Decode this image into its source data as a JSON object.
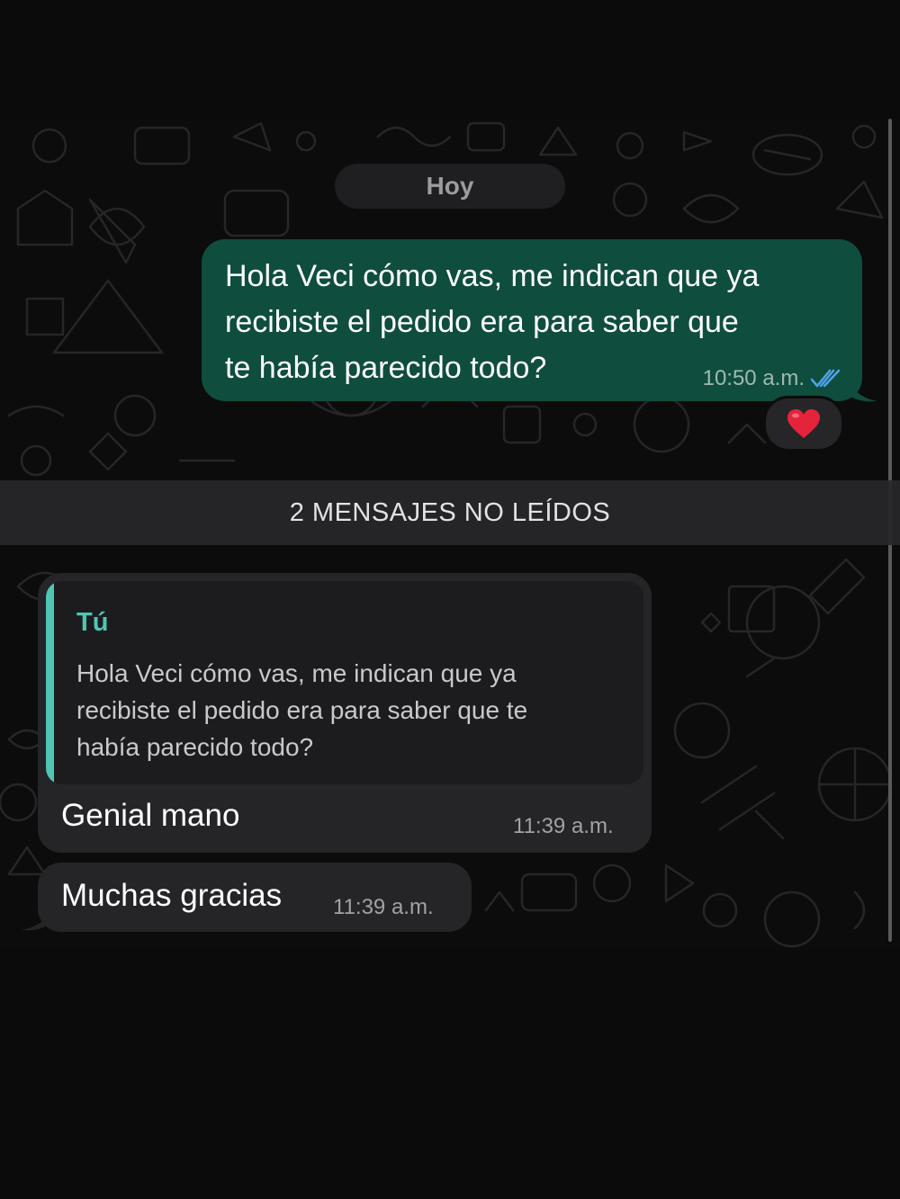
{
  "chat": {
    "date_label": "Hoy",
    "outgoing_message": {
      "lines": [
        "Hola Veci cómo vas, me indican que ya",
        "recibiste el pedido era para saber que",
        "te había parecido todo?"
      ],
      "time": "10:50 a.m.",
      "status_icon": "double-check-icon",
      "reaction": "❤️"
    },
    "unread_divider": "2 MENSAJES NO LEÍDOS",
    "incoming_messages": [
      {
        "quoted_author": "Tú",
        "quoted_lines": [
          "Hola Veci cómo vas, me indican que ya",
          "recibiste el pedido era para saber que te",
          "había parecido todo?"
        ],
        "text": "Genial mano",
        "time": "11:39 a.m."
      },
      {
        "text": "Muchas gracias",
        "time": "11:39 a.m."
      }
    ]
  },
  "colors": {
    "outgoing_bubble": "#0f4d3f",
    "incoming_bubble": "#252527",
    "quote_accent": "#4fc6b4",
    "read_ticks": "#4fa3e8"
  }
}
